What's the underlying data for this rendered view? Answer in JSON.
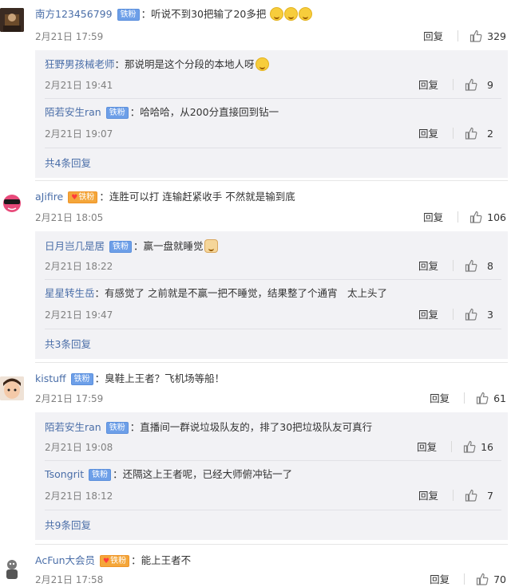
{
  "like_icon": "thumbs-up-icon",
  "reply_label": "回复",
  "comments": [
    {
      "username": "南方123456799",
      "badge": "铁粉",
      "text": "听说不到30把输了20多把",
      "emojis": 3,
      "time": "2月21日 17:59",
      "likes": "329",
      "replies": [
        {
          "username": "狂野男孩械老师",
          "badge": "",
          "text": "那说明是这个分段的本地人呀",
          "time": "2月21日 19:41",
          "likes": "9"
        },
        {
          "username": "陌若安生ran",
          "badge": "铁粉",
          "text": "哈哈哈，从200分直接回到钻一",
          "time": "2月21日 19:07",
          "likes": "2"
        }
      ],
      "more": "共4条回复"
    },
    {
      "username": "aJifire",
      "badge": "铁粉",
      "text": "连胜可以打 连输赶紧收手 不然就是输到底",
      "time": "2月21日 18:05",
      "likes": "106",
      "replies": [
        {
          "username": "日月岂几是居",
          "badge": "铁粉",
          "text": "赢一盘就睡觉",
          "time": "2月21日 18:22",
          "likes": "8"
        },
        {
          "username": "星星转生岳",
          "badge": "",
          "text": "有感觉了 之前就是不赢一把不睡觉，结果整了个通宵　太上头了",
          "time": "2月21日 19:47",
          "likes": "3"
        }
      ],
      "more": "共3条回复"
    },
    {
      "username": "kistuff",
      "badge": "铁粉",
      "text": "臭鞋上王者？飞机场等船！",
      "time": "2月21日 17:59",
      "likes": "61",
      "replies": [
        {
          "username": "陌若安生ran",
          "badge": "铁粉",
          "text": "直播间一群说垃圾队友的，排了30把垃圾队友可真行",
          "time": "2月21日 19:08",
          "likes": "16"
        },
        {
          "username": "Tsongrit",
          "badge": "铁粉",
          "text": "还隔这上王者呢，已经大师俯冲钻一了",
          "time": "2月21日 18:12",
          "likes": "7"
        }
      ],
      "more": "共9条回复"
    },
    {
      "username": "AcFun大会员",
      "badge": "铁粉",
      "text": "能上王者不",
      "time": "2月21日 17:58",
      "likes": "70",
      "replies": [],
      "more": ""
    }
  ]
}
